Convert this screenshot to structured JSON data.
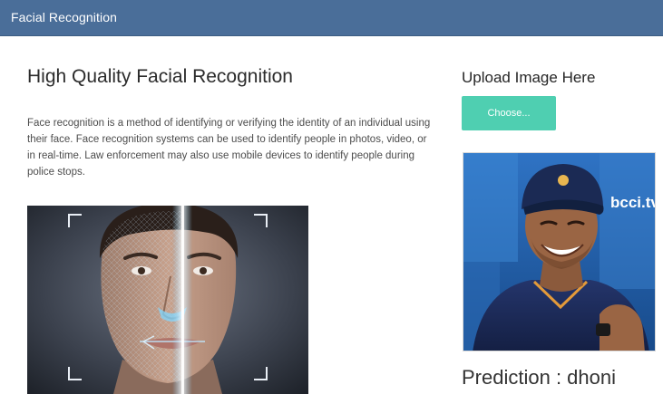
{
  "navbar": {
    "brand": "Facial Recognition"
  },
  "main": {
    "title": "High Quality Facial Recognition",
    "description": "Face recognition is a method of identifying or verifying the identity of an individual using their face. Face recognition systems can be used to identify people in photos, video, or in real-time. Law enforcement may also use mobile devices to identify people during police stops."
  },
  "upload": {
    "title": "Upload Image Here",
    "button_label": "Choose...",
    "backdrop_text": "bcci.tv"
  },
  "prediction": {
    "text": "Prediction : dhoni"
  },
  "colors": {
    "navbar": "#4a6e99",
    "button": "#4fcfb1"
  }
}
